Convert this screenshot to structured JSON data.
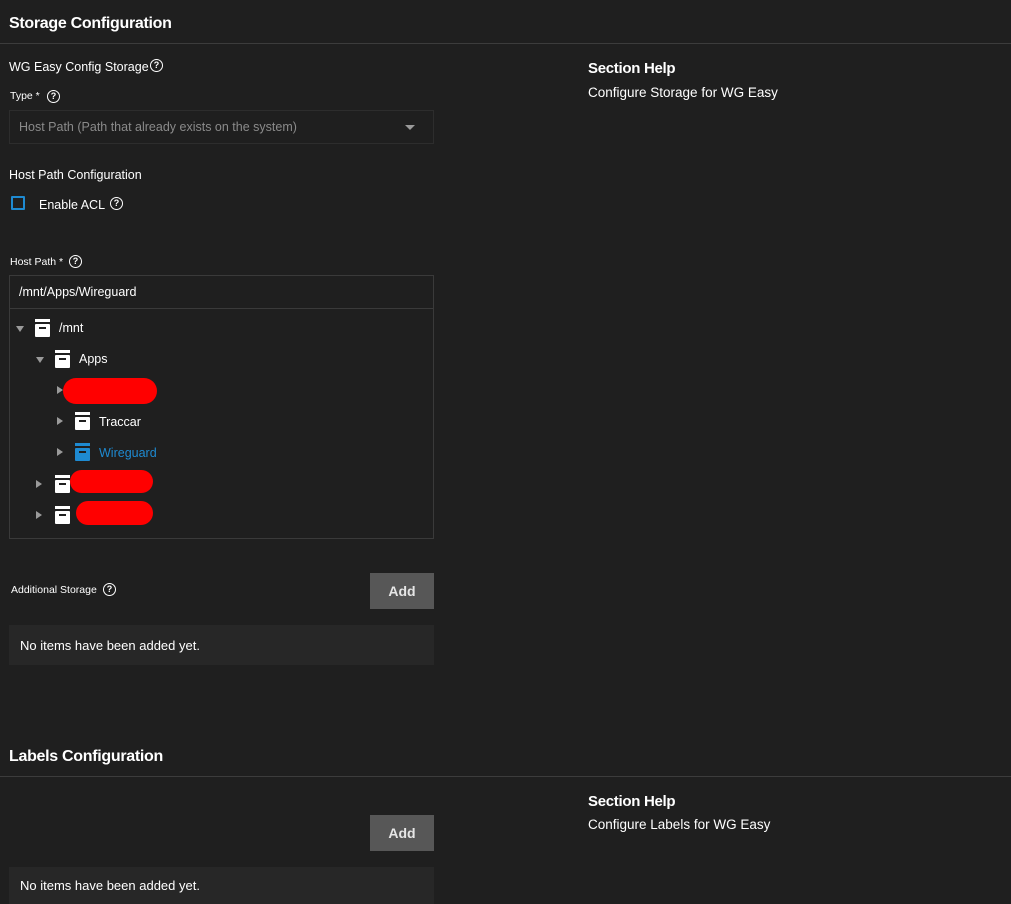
{
  "storage": {
    "title": "Storage Configuration",
    "config_storage_label": "WG Easy Config Storage",
    "type_label": "Type *",
    "type_value": "Host Path (Path that already exists on the system)",
    "host_path_config_label": "Host Path Configuration",
    "enable_acl_label": "Enable ACL",
    "enable_acl_checked": false,
    "host_path_label": "Host Path *",
    "host_path_value": "/mnt/Apps/Wireguard",
    "tree": {
      "root": "/mnt",
      "apps": "Apps",
      "traccar": "Traccar",
      "wireguard": "Wireguard"
    },
    "additional_storage_label": "Additional Storage",
    "add_label": "Add",
    "empty_text": "No items have been added yet.",
    "help_title": "Section Help",
    "help_text": "Configure Storage for WG Easy"
  },
  "labels": {
    "title": "Labels Configuration",
    "add_label": "Add",
    "empty_text": "No items have been added yet.",
    "help_title": "Section Help",
    "help_text": "Configure Labels for WG Easy"
  },
  "colors": {
    "background": "#1f1f1f",
    "accent_blue": "#1e8ad1",
    "button_bg": "#575757",
    "redaction": "#ff0000"
  }
}
